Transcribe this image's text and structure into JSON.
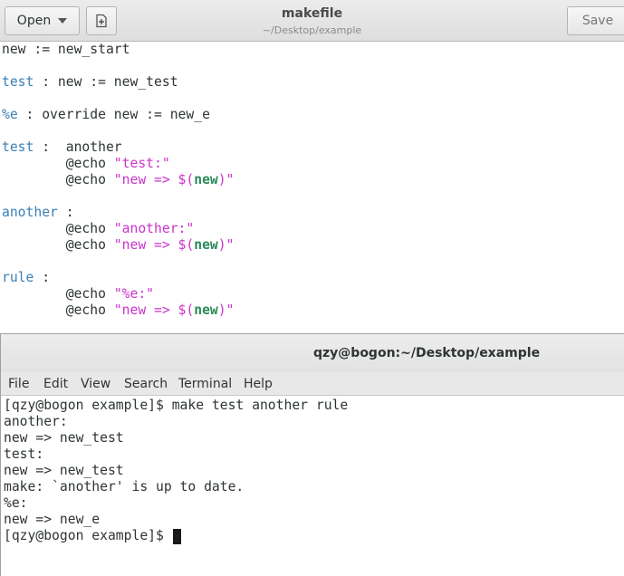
{
  "editor_window": {
    "open_label": "Open",
    "save_label": "Save",
    "title": "makefile",
    "subtitle": "~/Desktop/example",
    "code": {
      "l1": "new := new_start",
      "l2_target": "test",
      "l2_rest": " : new := new_test",
      "l3_target": "%e",
      "l3_rest": " : override new := new_e",
      "l4_target": "test",
      "l4_rest": " :  another",
      "echo_cmd": "        @echo ",
      "str_test": "\"test:\"",
      "str_new_open": "\"new => $(",
      "var_new": "new",
      "str_close": ")\"",
      "l8_target": "another",
      "l8_rest": " :",
      "str_another": "\"another:\"",
      "l12_target": "rule",
      "l12_rest": " :",
      "str_e": "\"%e:\""
    }
  },
  "terminal_window": {
    "title": "qzy@bogon:~/Desktop/example",
    "menu": [
      "File",
      "Edit",
      "View",
      "Search",
      "Terminal",
      "Help"
    ],
    "lines": [
      "[qzy@bogon example]$ make test another rule",
      "another:",
      "new => new_test",
      "test:",
      "new => new_test",
      "make: `another' is up to date.",
      "%e:",
      "new => new_e"
    ],
    "prompt": "[qzy@bogon example]$ "
  }
}
